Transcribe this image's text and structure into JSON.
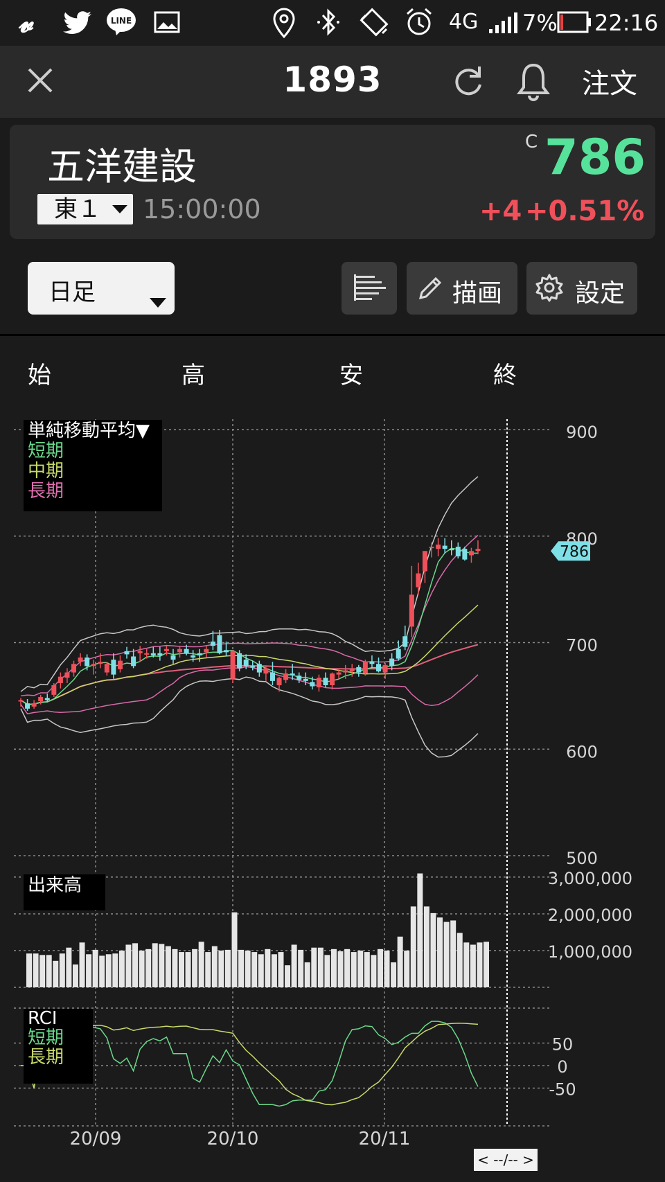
{
  "status": {
    "battery": "7%",
    "time": "22:16",
    "network": "4G"
  },
  "header": {
    "code": "1893",
    "order_label": "注文"
  },
  "quote": {
    "name": "五洋建設",
    "market": "東１",
    "time": "15:00:00",
    "price_prefix": "C",
    "price": "786",
    "change": "+4",
    "change_pct": "+0.51%",
    "up_color": "#56e29a",
    "down_color": "#f0505a"
  },
  "toolbar": {
    "period": "日足",
    "draw_label": "描画",
    "settings_label": "設定"
  },
  "ohlc_labels": {
    "open": "始",
    "high": "高",
    "low": "安",
    "close": "終"
  },
  "indicators": {
    "main_title": "単純移動平均▼",
    "short": "短期",
    "mid": "中期",
    "long": "長期",
    "volume_title": "出来高",
    "rci_title": "RCI",
    "rci_short": "短期",
    "rci_long": "長期"
  },
  "axis": {
    "price_ticks": [
      "900",
      "800",
      "700",
      "600",
      "500"
    ],
    "volume_ticks": [
      "3,000,000",
      "2,000,000",
      "1,000,000"
    ],
    "rci_ticks": [
      "50",
      "0",
      "-50"
    ],
    "x_ticks": [
      "20/09",
      "20/10",
      "20/11"
    ]
  },
  "current_price_tag": "786",
  "nav_label": "< --/-- >",
  "chart_data": {
    "type": "candlestick",
    "ylim": [
      500,
      900
    ],
    "candles": [
      [
        645,
        648,
        640,
        646
      ],
      [
        643,
        647,
        636,
        638
      ],
      [
        640,
        646,
        638,
        643
      ],
      [
        645,
        651,
        642,
        649
      ],
      [
        648,
        652,
        644,
        646
      ],
      [
        651,
        662,
        649,
        660
      ],
      [
        662,
        672,
        657,
        668
      ],
      [
        667,
        676,
        662,
        672
      ],
      [
        672,
        683,
        668,
        680
      ],
      [
        682,
        690,
        678,
        686
      ],
      [
        686,
        689,
        674,
        678
      ],
      [
        678,
        684,
        670,
        680
      ],
      [
        680,
        690,
        676,
        682
      ],
      [
        672,
        682,
        669,
        680
      ],
      [
        684,
        690,
        666,
        670
      ],
      [
        675,
        688,
        672,
        683
      ],
      [
        692,
        696,
        685,
        689
      ],
      [
        687,
        694,
        676,
        678
      ],
      [
        690,
        697,
        682,
        692
      ],
      [
        689,
        694,
        685,
        690
      ],
      [
        690,
        696,
        686,
        688
      ],
      [
        690,
        696,
        683,
        688
      ],
      [
        692,
        697,
        688,
        694
      ],
      [
        688,
        694,
        680,
        684
      ],
      [
        691,
        697,
        686,
        694
      ],
      [
        694,
        698,
        688,
        690
      ],
      [
        688,
        693,
        682,
        686
      ],
      [
        690,
        694,
        682,
        688
      ],
      [
        691,
        697,
        686,
        694
      ],
      [
        701,
        711,
        693,
        697
      ],
      [
        707,
        712,
        689,
        690
      ],
      [
        693,
        701,
        687,
        691
      ],
      [
        666,
        693,
        662,
        692
      ],
      [
        690,
        693,
        673,
        676
      ],
      [
        684,
        689,
        675,
        678
      ],
      [
        678,
        683,
        674,
        677
      ],
      [
        680,
        683,
        668,
        672
      ],
      [
        671,
        678,
        664,
        676
      ],
      [
        672,
        682,
        660,
        664
      ],
      [
        660,
        668,
        654,
        667
      ],
      [
        665,
        675,
        662,
        671
      ],
      [
        671,
        680,
        665,
        670
      ],
      [
        669,
        672,
        662,
        665
      ],
      [
        666,
        672,
        660,
        664
      ],
      [
        663,
        668,
        656,
        659
      ],
      [
        658,
        670,
        654,
        667
      ],
      [
        667,
        672,
        658,
        660
      ],
      [
        660,
        672,
        656,
        671
      ],
      [
        670,
        676,
        666,
        672
      ],
      [
        672,
        679,
        666,
        674
      ],
      [
        673,
        680,
        668,
        675
      ],
      [
        677,
        679,
        668,
        672
      ],
      [
        671,
        684,
        669,
        682
      ],
      [
        682,
        688,
        676,
        680
      ],
      [
        680,
        686,
        672,
        673
      ],
      [
        672,
        681,
        666,
        679
      ],
      [
        685,
        690,
        674,
        678
      ],
      [
        694,
        702,
        683,
        685
      ],
      [
        706,
        716,
        693,
        696
      ],
      [
        715,
        772,
        705,
        745
      ],
      [
        752,
        775,
        745,
        765
      ],
      [
        767,
        786,
        756,
        786
      ],
      [
        790,
        794,
        780,
        790
      ],
      [
        788,
        798,
        781,
        792
      ],
      [
        791,
        798,
        784,
        788
      ],
      [
        788,
        796,
        782,
        787
      ],
      [
        790,
        794,
        779,
        781
      ],
      [
        788,
        790,
        777,
        778
      ],
      [
        782,
        789,
        775,
        786
      ],
      [
        786,
        796,
        783,
        788
      ]
    ],
    "volume": [
      920000,
      920000,
      880000,
      880000,
      720000,
      920000,
      1080000,
      620000,
      1220000,
      900000,
      1020000,
      860000,
      900000,
      920000,
      1000000,
      1160000,
      1200000,
      1000000,
      1040000,
      1200000,
      1180000,
      1120000,
      1040000,
      960000,
      960000,
      1040000,
      1240000,
      960000,
      1120000,
      1000000,
      1020000,
      2040000,
      1020000,
      1000000,
      960000,
      900000,
      1040000,
      900000,
      960000,
      600000,
      1160000,
      1020000,
      680000,
      1080000,
      1080000,
      880000,
      1040000,
      980000,
      1040000,
      960000,
      1000000,
      960000,
      880000,
      1040000,
      1000000,
      680000,
      1380000,
      1000000,
      2200000,
      3100000,
      2200000,
      2020000,
      1900000,
      1780000,
      1820000,
      1480000,
      1220000,
      1160000,
      1220000,
      1240000
    ],
    "rci_ticks_note": "",
    "x_labels": [
      "20/09",
      "20/10",
      "20/11"
    ]
  }
}
